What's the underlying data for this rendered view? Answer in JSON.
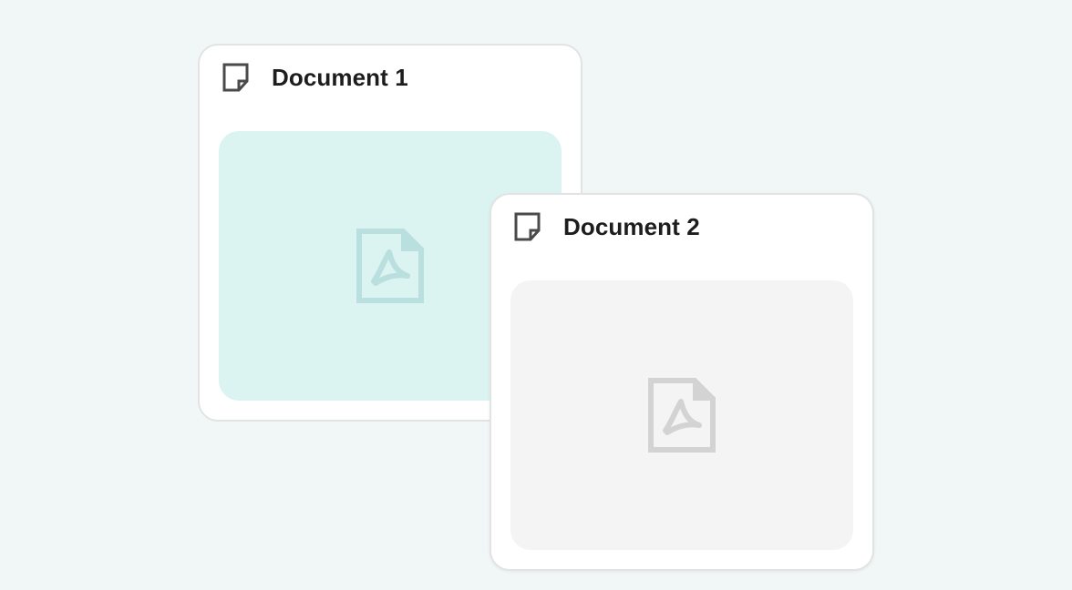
{
  "documents": [
    {
      "title": "Document 1",
      "icon": "document-icon",
      "preview_icon": "pdf-file-icon",
      "preview_color": "#dbf3f1",
      "preview_icon_color": "#b9dfde"
    },
    {
      "title": "Document 2",
      "icon": "document-icon",
      "preview_icon": "pdf-file-icon",
      "preview_color": "#f4f4f4",
      "preview_icon_color": "#d3d3d3"
    }
  ],
  "colors": {
    "background": "#f1f6f6",
    "card": "#ffffff",
    "card_border": "#e2e4e4",
    "title_text": "#1d1d1d",
    "icon_stroke": "#4a4a4a"
  }
}
